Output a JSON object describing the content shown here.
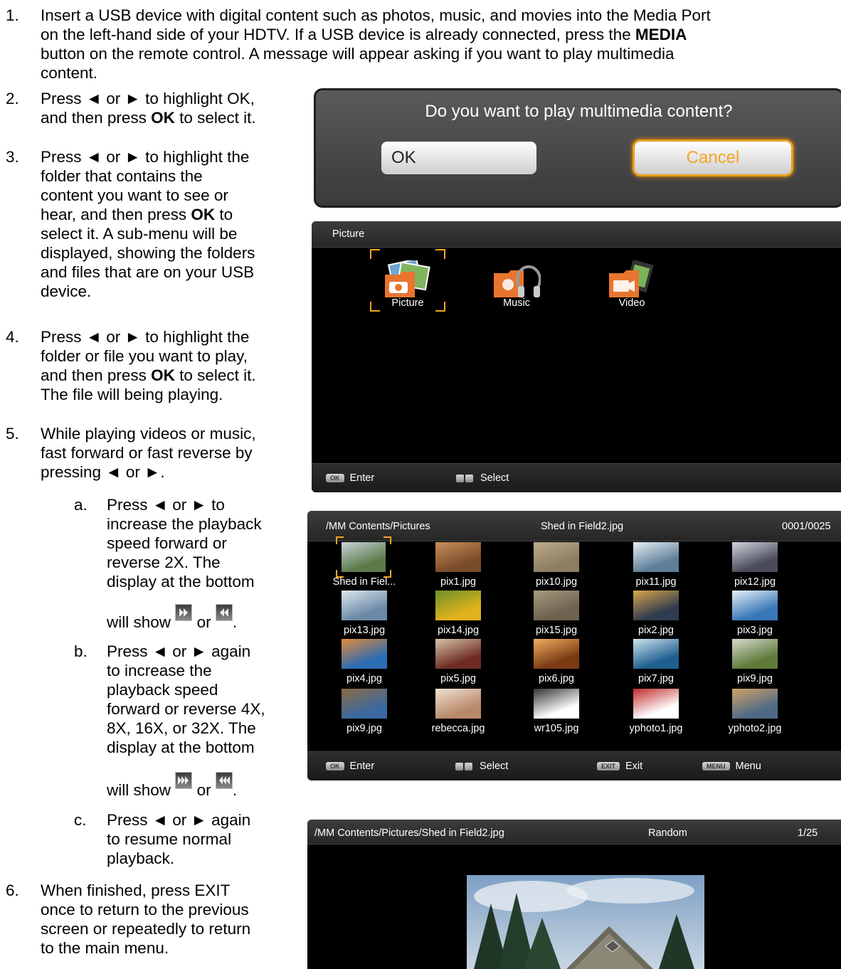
{
  "steps": {
    "s1": {
      "num": "1.",
      "text_a": "Insert a USB device with digital content such as photos, music, and movies into the Media Port",
      "text_b": "on the left-hand side of your HDTV. If a USB device is already connected, press the ",
      "text_b_bold": "MEDIA",
      "text_c": "button on the remote control. A message will appear asking if you want to play multimedia",
      "text_d": "content."
    },
    "s2": {
      "num": "2.",
      "l1": "Press ◄ or ► to highlight OK,",
      "l2a": "and then press ",
      "l2b": "OK",
      "l2c": " to select it."
    },
    "s3": {
      "num": "3.",
      "l1": "Press ◄ or ► to highlight the",
      "l2": "folder that contains the",
      "l3": "content you want to see or",
      "l4a": "hear, and then press ",
      "l4b": "OK",
      "l4c": " to",
      "l5": "select it. A sub-menu will be",
      "l6": "displayed, showing the folders",
      "l7": "and files that are on your USB",
      "l8": "device."
    },
    "s4": {
      "num": "4.",
      "l1": "Press ◄ or ► to highlight the",
      "l2": "folder or file you want to play,",
      "l3a": "and then press ",
      "l3b": "OK",
      "l3c": " to select it.",
      "l4": "The file will being playing."
    },
    "s5": {
      "num": "5.",
      "l1": "While playing videos or music,",
      "l2": "fast forward or fast reverse by",
      "l3": "pressing ◄ or ►."
    },
    "sa": {
      "num": "a.",
      "l1": "Press ◄ or ► to",
      "l2": "increase the playback",
      "l3": "speed forward or",
      "l4": "reverse 2X. The",
      "l5": "display at the bottom",
      "l6a": "will show",
      "l6b": "or",
      "l6c": "."
    },
    "sb": {
      "num": "b.",
      "l1": "Press ◄ or ► again",
      "l2": "to increase the",
      "l3": "playback speed",
      "l4": "forward or reverse 4X,",
      "l5": "8X, 16X, or 32X. The",
      "l6": "display at the bottom",
      "l7a": "will show",
      "l7b": "or",
      "l7c": "."
    },
    "sc": {
      "num": "c.",
      "l1": "Press ◄ or ► again",
      "l2": "to resume normal",
      "l3": "playback."
    },
    "s6": {
      "num": "6.",
      "l1": "When finished, press EXIT",
      "l2": "once to return to the previous",
      "l3": "screen or repeatedly to return",
      "l4": "to the main menu."
    }
  },
  "dialog": {
    "question": "Do you want to play multimedia content?",
    "ok": "OK",
    "cancel": "Cancel"
  },
  "menu_screen": {
    "title": "Picture",
    "items": [
      {
        "label": "Picture",
        "icon": "picture-folder-icon"
      },
      {
        "label": "Music",
        "icon": "music-folder-icon"
      },
      {
        "label": "Video",
        "icon": "video-folder-icon"
      }
    ],
    "footer": {
      "enter_key": "OK",
      "enter": "Enter",
      "select": "Select"
    }
  },
  "browser_screen": {
    "path": "/MM Contents/Pictures",
    "current": "Shed in Field2.jpg",
    "count": "0001/0025",
    "files": [
      "Shed in Fiel...",
      "pix1.jpg",
      "pix10.jpg",
      "pix11.jpg",
      "pix12.jpg",
      "pix13.jpg",
      "pix14.jpg",
      "pix15.jpg",
      "pix2.jpg",
      "pix3.jpg",
      "pix4.jpg",
      "pix5.jpg",
      "pix6.jpg",
      "pix7.jpg",
      "pix9.jpg",
      "pix9.jpg",
      "rebecca.jpg",
      "wr105.jpg",
      "yphoto1.jpg",
      "yphoto2.jpg"
    ],
    "footer": {
      "enter_key": "OK",
      "enter": "Enter",
      "select": "Select",
      "exit_key": "EXIT",
      "exit": "Exit",
      "menu_key": "MENU",
      "menu": "Menu"
    }
  },
  "viewer_screen": {
    "path": "/MM Contents/Pictures/Shed in Field2.jpg",
    "mode": "Random",
    "index": "1/25"
  },
  "colors": {
    "highlight": "#f5a623",
    "panel_bg": "#000000"
  }
}
